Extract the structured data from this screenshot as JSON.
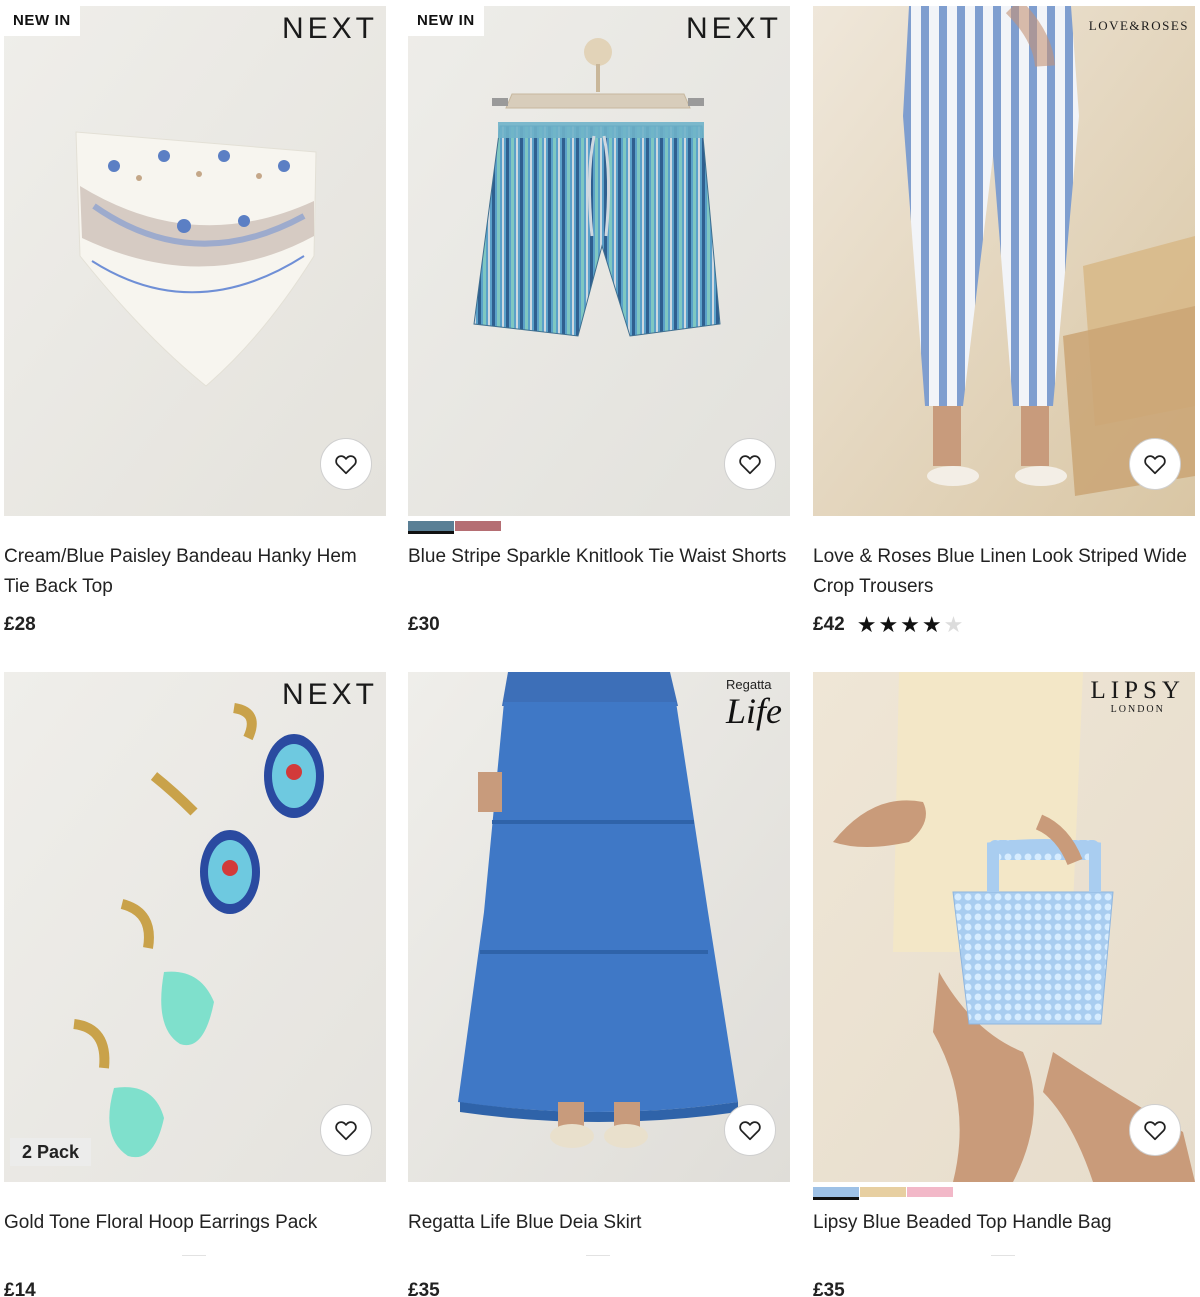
{
  "products": [
    {
      "badge": "NEW IN",
      "brand": "NEXT",
      "title": "Cream/Blue Paisley Bandeau Hanky Hem Tie Back Top",
      "price": "£28"
    },
    {
      "badge": "NEW IN",
      "brand": "NEXT",
      "title": "Blue Stripe Sparkle Knitlook Tie Waist Shorts",
      "price": "£30",
      "swatch_colors": [
        "#5a7f95",
        "#b56e73"
      ]
    },
    {
      "brand": "LOVE&ROSES",
      "title": "Love & Roses Blue Linen Look Striped Wide Crop Trousers",
      "price": "£42",
      "rating": 4,
      "rating_max": 5
    },
    {
      "brand": "NEXT",
      "pack_label": "2 Pack",
      "title": "Gold Tone Floral Hoop Earrings Pack",
      "price": "£14"
    },
    {
      "brand_line1": "Regatta",
      "brand_line2": "Life",
      "title": "Regatta Life Blue Deia Skirt",
      "price": "£35"
    },
    {
      "brand_line1": "LIPSY",
      "brand_line2": "LONDON",
      "title": "Lipsy Blue Beaded Top Handle Bag",
      "price": "£35",
      "swatch_colors": [
        "#9ec1e6",
        "#e7cfa1",
        "#f2b8c8"
      ]
    }
  ],
  "icons": {
    "favourite": "heart-outline-icon",
    "rating": "star-icon"
  },
  "colors": {
    "text": "#222222",
    "star": "#111111",
    "star_empty": "#dcdcdc"
  }
}
